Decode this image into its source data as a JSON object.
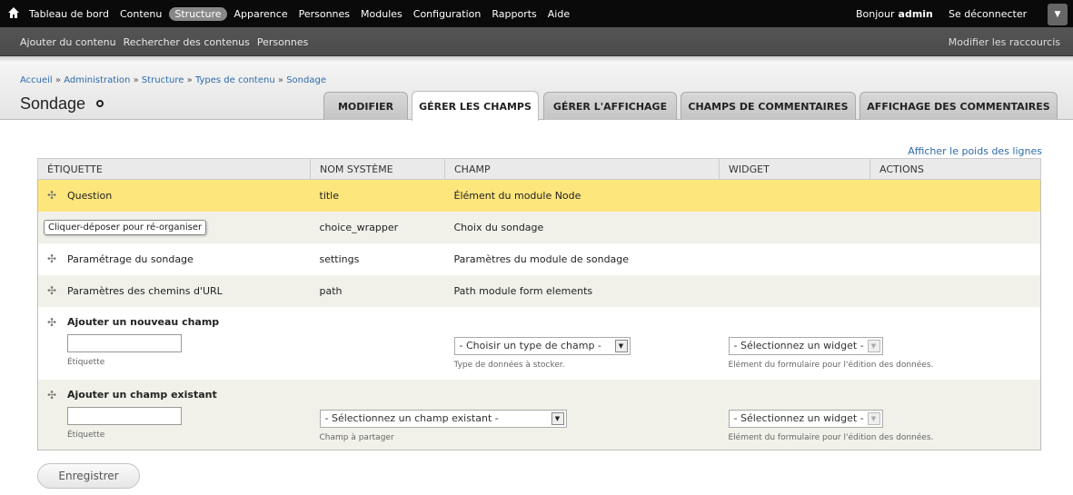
{
  "toolbar": {
    "menu": [
      "Tableau de bord",
      "Contenu",
      "Structure",
      "Apparence",
      "Personnes",
      "Modules",
      "Configuration",
      "Rapports",
      "Aide"
    ],
    "greeting": "Bonjour",
    "username": "admin",
    "logout": "Se déconnecter"
  },
  "shortcuts": {
    "links": [
      "Ajouter du contenu",
      "Rechercher des contenus",
      "Personnes"
    ],
    "edit": "Modifier les raccourcis"
  },
  "breadcrumb": [
    "Accueil",
    "Administration",
    "Structure",
    "Types de contenu",
    "Sondage"
  ],
  "breadcrumb_sep": "»",
  "page_title": "Sondage",
  "tabs": [
    "Modifier",
    "Gérer les champs",
    "Gérer l'affichage",
    "Champs de commentaires",
    "Affichage des commentaires"
  ],
  "show_weights": "Afficher le poids des lignes",
  "table": {
    "headers": [
      "Étiquette",
      "Nom système",
      "Champ",
      "Widget",
      "Actions"
    ],
    "rows": [
      {
        "label": "Question",
        "machine": "title",
        "field": "Élément du module Node"
      },
      {
        "label": "Choix du sondage",
        "machine": "choice_wrapper",
        "field": "Choix du sondage",
        "tooltip": "Cliquer-déposer pour ré-organiser"
      },
      {
        "label": "Paramétrage du sondage",
        "machine": "settings",
        "field": "Paramètres du module de sondage"
      },
      {
        "label": "Paramètres des chemins d'URL",
        "machine": "path",
        "field": "Path module form elements"
      }
    ],
    "add_new": {
      "title": "Ajouter un nouveau champ",
      "label_desc": "Étiquette",
      "type_select": "- Choisir un type de champ -",
      "type_desc": "Type de données à stocker.",
      "widget_select": "- Sélectionnez un widget -",
      "widget_desc": "Elément du formulaire pour l'édition des données."
    },
    "add_existing": {
      "title": "Ajouter un champ existant",
      "label_desc": "Étiquette",
      "field_select": "- Sélectionnez un champ existant -",
      "field_desc": "Champ à partager",
      "widget_select": "- Sélectionnez un widget -",
      "widget_desc": "Elément du formulaire pour l'édition des données."
    }
  },
  "save": "Enregistrer"
}
